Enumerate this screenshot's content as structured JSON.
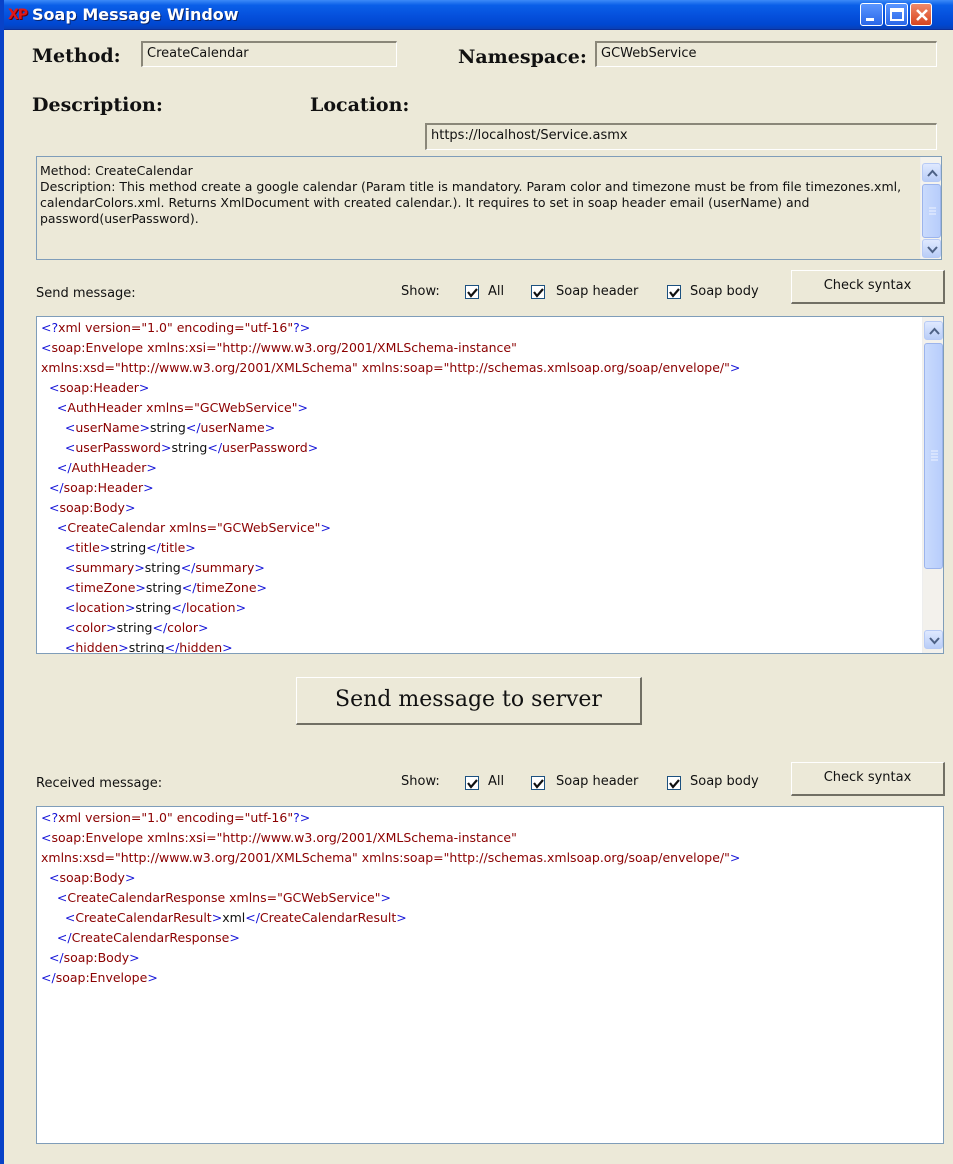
{
  "window": {
    "title": "Soap Message Window",
    "icon": "xp-icon",
    "buttons": [
      "minimize-icon",
      "maximize-icon",
      "close-icon"
    ]
  },
  "method": {
    "label": "Method:",
    "value": "CreateCalendar"
  },
  "namespace": {
    "label": "Namespace:",
    "value": "GCWebService"
  },
  "description": {
    "label": "Description:"
  },
  "location": {
    "label": "Location:",
    "value": "https://localhost/Service.asmx"
  },
  "description_text": "Method: CreateCalendar\nDescription: This method create a google calendar (Param title is mandatory. Param color and timezone must be from file timezones.xml, calendarColors.xml. Returns XmlDocument with created calendar.). It requires to set in soap header email (userName) and password(userPassword).",
  "send": {
    "label": "Send message:",
    "show_label": "Show:",
    "all_label": "All",
    "header_label": "Soap header",
    "body_label": "Soap body",
    "all_checked": true,
    "header_checked": true,
    "body_checked": true,
    "check_syntax_label": "Check syntax"
  },
  "send_button_label": "Send message to server",
  "received": {
    "label": "Received message:",
    "show_label": "Show:",
    "all_label": "All",
    "header_label": "Soap header",
    "body_label": "Soap body",
    "all_checked": true,
    "header_checked": true,
    "body_checked": true,
    "check_syntax_label": "Check syntax"
  },
  "send_xml": [
    [
      [
        "b",
        "<?"
      ],
      [
        "r",
        "xml version=\"1.0\" encoding=\"utf-16\""
      ],
      [
        "b",
        "?>"
      ]
    ],
    [
      [
        "b",
        "<"
      ],
      [
        "r",
        "soap:Envelope xmlns:xsi=\"http://www.w3.org/2001/XMLSchema-instance\""
      ]
    ],
    [
      [
        "r",
        "xmlns:xsd=\"http://www.w3.org/2001/XMLSchema\" xmlns:soap=\"http://schemas.xmlsoap.org/soap/envelope/\""
      ],
      [
        "b",
        ">"
      ]
    ],
    [
      [
        "k",
        "  "
      ],
      [
        "b",
        "<"
      ],
      [
        "r",
        "soap:Header"
      ],
      [
        "b",
        ">"
      ]
    ],
    [
      [
        "k",
        "    "
      ],
      [
        "b",
        "<"
      ],
      [
        "r",
        "AuthHeader xmlns=\"GCWebService\""
      ],
      [
        "b",
        ">"
      ]
    ],
    [
      [
        "k",
        "      "
      ],
      [
        "b",
        "<"
      ],
      [
        "r",
        "userName"
      ],
      [
        "b",
        ">"
      ],
      [
        "k",
        "string"
      ],
      [
        "b",
        "</"
      ],
      [
        "r",
        "userName"
      ],
      [
        "b",
        ">"
      ]
    ],
    [
      [
        "k",
        "      "
      ],
      [
        "b",
        "<"
      ],
      [
        "r",
        "userPassword"
      ],
      [
        "b",
        ">"
      ],
      [
        "k",
        "string"
      ],
      [
        "b",
        "</"
      ],
      [
        "r",
        "userPassword"
      ],
      [
        "b",
        ">"
      ]
    ],
    [
      [
        "k",
        "    "
      ],
      [
        "b",
        "</"
      ],
      [
        "r",
        "AuthHeader"
      ],
      [
        "b",
        ">"
      ]
    ],
    [
      [
        "k",
        "  "
      ],
      [
        "b",
        "</"
      ],
      [
        "r",
        "soap:Header"
      ],
      [
        "b",
        ">"
      ]
    ],
    [
      [
        "k",
        "  "
      ],
      [
        "b",
        "<"
      ],
      [
        "r",
        "soap:Body"
      ],
      [
        "b",
        ">"
      ]
    ],
    [
      [
        "k",
        "    "
      ],
      [
        "b",
        "<"
      ],
      [
        "r",
        "CreateCalendar xmlns=\"GCWebService\""
      ],
      [
        "b",
        ">"
      ]
    ],
    [
      [
        "k",
        "      "
      ],
      [
        "b",
        "<"
      ],
      [
        "r",
        "title"
      ],
      [
        "b",
        ">"
      ],
      [
        "k",
        "string"
      ],
      [
        "b",
        "</"
      ],
      [
        "r",
        "title"
      ],
      [
        "b",
        ">"
      ]
    ],
    [
      [
        "k",
        "      "
      ],
      [
        "b",
        "<"
      ],
      [
        "r",
        "summary"
      ],
      [
        "b",
        ">"
      ],
      [
        "k",
        "string"
      ],
      [
        "b",
        "</"
      ],
      [
        "r",
        "summary"
      ],
      [
        "b",
        ">"
      ]
    ],
    [
      [
        "k",
        "      "
      ],
      [
        "b",
        "<"
      ],
      [
        "r",
        "timeZone"
      ],
      [
        "b",
        ">"
      ],
      [
        "k",
        "string"
      ],
      [
        "b",
        "</"
      ],
      [
        "r",
        "timeZone"
      ],
      [
        "b",
        ">"
      ]
    ],
    [
      [
        "k",
        "      "
      ],
      [
        "b",
        "<"
      ],
      [
        "r",
        "location"
      ],
      [
        "b",
        ">"
      ],
      [
        "k",
        "string"
      ],
      [
        "b",
        "</"
      ],
      [
        "r",
        "location"
      ],
      [
        "b",
        ">"
      ]
    ],
    [
      [
        "k",
        "      "
      ],
      [
        "b",
        "<"
      ],
      [
        "r",
        "color"
      ],
      [
        "b",
        ">"
      ],
      [
        "k",
        "string"
      ],
      [
        "b",
        "</"
      ],
      [
        "r",
        "color"
      ],
      [
        "b",
        ">"
      ]
    ],
    [
      [
        "k",
        "      "
      ],
      [
        "b",
        "<"
      ],
      [
        "r",
        "hidden"
      ],
      [
        "b",
        ">"
      ],
      [
        "k",
        "string"
      ],
      [
        "b",
        "</"
      ],
      [
        "r",
        "hidden"
      ],
      [
        "b",
        ">"
      ]
    ]
  ],
  "received_xml": [
    [
      [
        "b",
        "<?"
      ],
      [
        "r",
        "xml version=\"1.0\" encoding=\"utf-16\""
      ],
      [
        "b",
        "?>"
      ]
    ],
    [
      [
        "b",
        "<"
      ],
      [
        "r",
        "soap:Envelope xmlns:xsi=\"http://www.w3.org/2001/XMLSchema-instance\""
      ]
    ],
    [
      [
        "r",
        "xmlns:xsd=\"http://www.w3.org/2001/XMLSchema\" xmlns:soap=\"http://schemas.xmlsoap.org/soap/envelope/\""
      ],
      [
        "b",
        ">"
      ]
    ],
    [
      [
        "k",
        "  "
      ],
      [
        "b",
        "<"
      ],
      [
        "r",
        "soap:Body"
      ],
      [
        "b",
        ">"
      ]
    ],
    [
      [
        "k",
        "    "
      ],
      [
        "b",
        "<"
      ],
      [
        "r",
        "CreateCalendarResponse xmlns=\"GCWebService\""
      ],
      [
        "b",
        ">"
      ]
    ],
    [
      [
        "k",
        "      "
      ],
      [
        "b",
        "<"
      ],
      [
        "r",
        "CreateCalendarResult"
      ],
      [
        "b",
        ">"
      ],
      [
        "k",
        "xml"
      ],
      [
        "b",
        "</"
      ],
      [
        "r",
        "CreateCalendarResult"
      ],
      [
        "b",
        ">"
      ]
    ],
    [
      [
        "k",
        "    "
      ],
      [
        "b",
        "</"
      ],
      [
        "r",
        "CreateCalendarResponse"
      ],
      [
        "b",
        ">"
      ]
    ],
    [
      [
        "k",
        "  "
      ],
      [
        "b",
        "</"
      ],
      [
        "r",
        "soap:Body"
      ],
      [
        "b",
        ">"
      ]
    ],
    [
      [
        "b",
        "</"
      ],
      [
        "r",
        "soap:Envelope"
      ],
      [
        "b",
        ">"
      ]
    ]
  ]
}
